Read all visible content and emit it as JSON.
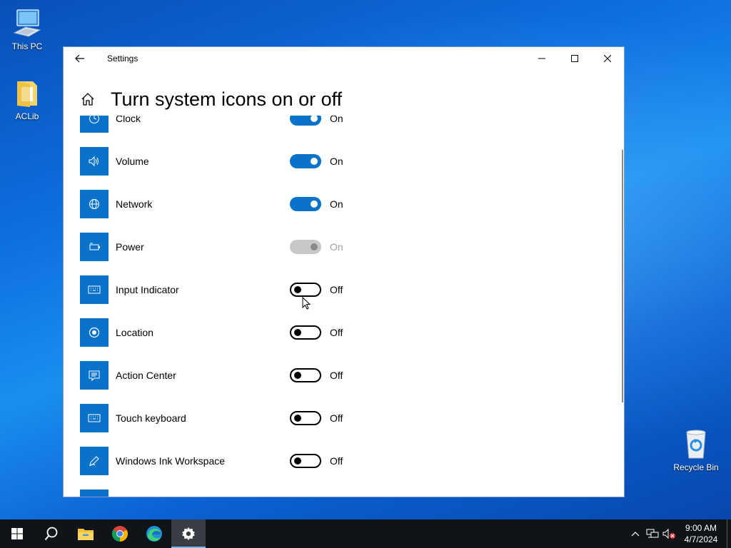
{
  "desktop": {
    "icons": [
      {
        "label": "This PC",
        "icon": "computer-icon"
      },
      {
        "label": "ACLib",
        "icon": "folder-icon"
      },
      {
        "label": "Recycle Bin",
        "icon": "recycle-bin-icon"
      }
    ]
  },
  "window": {
    "title": "Settings",
    "page_title": "Turn system icons on or off"
  },
  "colors": {
    "accent": "#0a72c9",
    "disabled_track": "#c8c8c8"
  },
  "items": [
    {
      "label": "Clock",
      "icon": "clock-icon",
      "state": "On",
      "status": "on"
    },
    {
      "label": "Volume",
      "icon": "volume-icon",
      "state": "On",
      "status": "on"
    },
    {
      "label": "Network",
      "icon": "globe-icon",
      "state": "On",
      "status": "on"
    },
    {
      "label": "Power",
      "icon": "battery-icon",
      "state": "On",
      "status": "disabled"
    },
    {
      "label": "Input Indicator",
      "icon": "keyboard-icon",
      "state": "Off",
      "status": "off"
    },
    {
      "label": "Location",
      "icon": "location-icon",
      "state": "Off",
      "status": "off"
    },
    {
      "label": "Action Center",
      "icon": "action-center-icon",
      "state": "Off",
      "status": "off"
    },
    {
      "label": "Touch keyboard",
      "icon": "keyboard-icon",
      "state": "Off",
      "status": "off"
    },
    {
      "label": "Windows Ink Workspace",
      "icon": "pen-icon",
      "state": "Off",
      "status": "off"
    }
  ],
  "taskbar": {
    "apps": [
      "start-icon",
      "search-icon",
      "file-explorer-icon",
      "chrome-icon",
      "edge-icon",
      "settings-icon"
    ],
    "clock_time": "9:00 AM",
    "clock_date": "4/7/2024"
  }
}
